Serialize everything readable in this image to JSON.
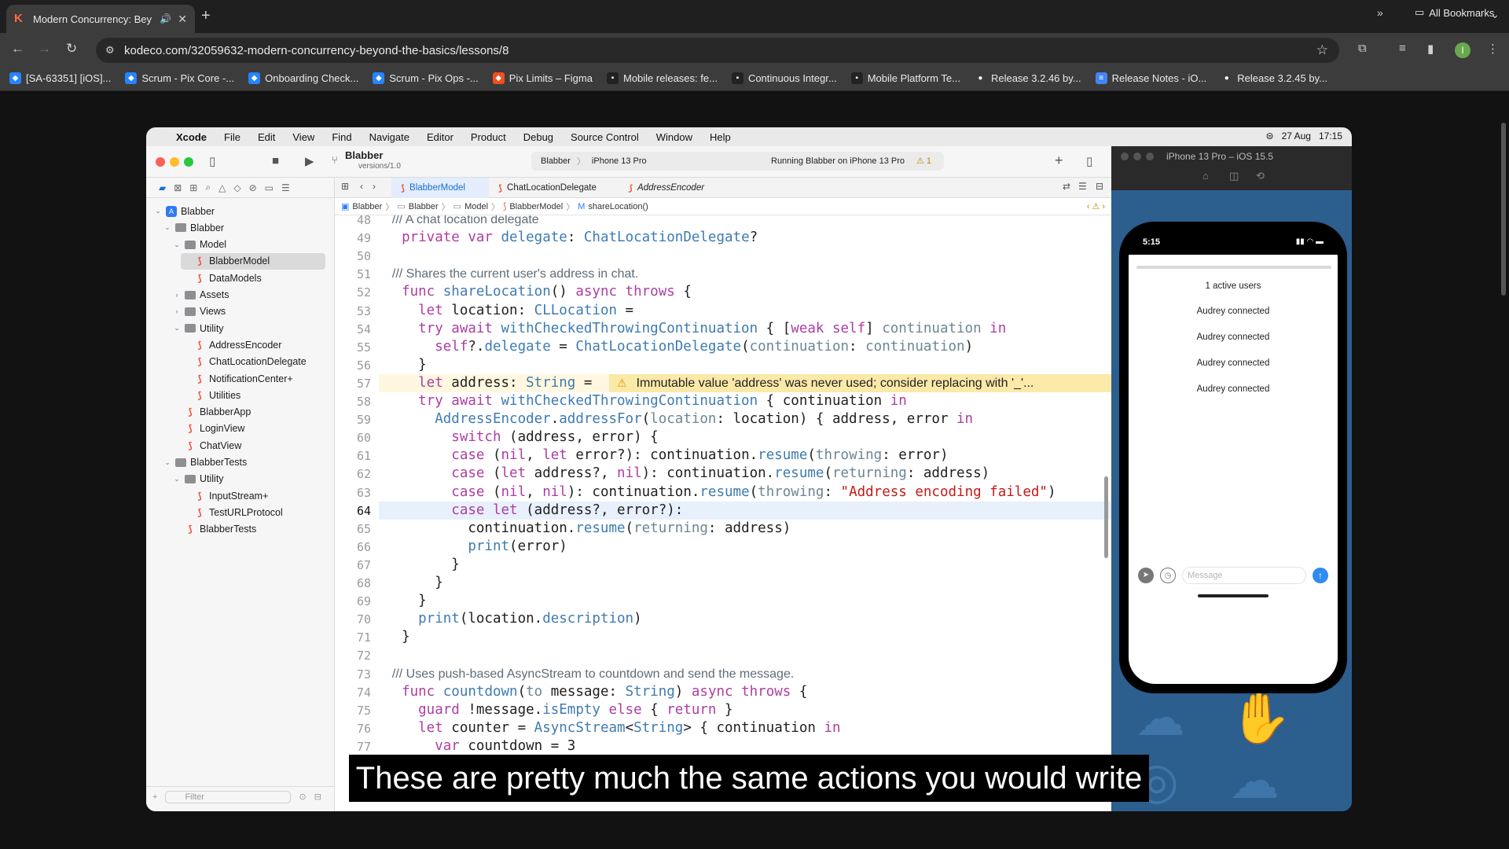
{
  "browser": {
    "tab_title": "Modern Concurrency: Bey",
    "url": "kodeco.com/32059632-modern-concurrency-beyond-the-basics/lessons/8",
    "profile_initial": "I",
    "bookmarks": [
      {
        "label": "[SA-63351] [iOS]...",
        "icon": "jira-icon",
        "color": "#2684ff"
      },
      {
        "label": "Scrum - Pix Core -...",
        "icon": "jira-icon",
        "color": "#2684ff"
      },
      {
        "label": "Onboarding Check...",
        "icon": "jira-icon",
        "color": "#2684ff"
      },
      {
        "label": "Scrum - Pix Ops -...",
        "icon": "jira-icon",
        "color": "#2684ff"
      },
      {
        "label": "Pix Limits – Figma",
        "icon": "figma-icon",
        "color": "#f24e1e"
      },
      {
        "label": "Mobile releases: fe...",
        "icon": "app-icon",
        "color": "#222222"
      },
      {
        "label": "Continuous Integr...",
        "icon": "app-icon",
        "color": "#222222"
      },
      {
        "label": "Mobile Platform Te...",
        "icon": "app-icon",
        "color": "#222222"
      },
      {
        "label": "Release 3.2.46 by...",
        "icon": "github-icon",
        "color": "#ffffff"
      },
      {
        "label": "Release Notes - iO...",
        "icon": "docs-icon",
        "color": "#4285f4"
      },
      {
        "label": "Release 3.2.45 by...",
        "icon": "github-icon",
        "color": "#ffffff"
      }
    ],
    "all_bookmarks": "All Bookmarks"
  },
  "menubar": {
    "app": "Xcode",
    "items": [
      "File",
      "Edit",
      "View",
      "Find",
      "Navigate",
      "Editor",
      "Product",
      "Debug",
      "Source Control",
      "Window",
      "Help"
    ],
    "date": "27 Aug",
    "time": "17:15"
  },
  "xcode": {
    "scheme": "Blabber",
    "scheme_sub": "versions/1.0",
    "run_target": "Blabber",
    "device": "iPhone 13 Pro",
    "status": "Running Blabber on iPhone 13 Pro",
    "warning_count": "1",
    "tabs": [
      "BlabberModel",
      "ChatLocationDelegate",
      "AddressEncoder"
    ],
    "jumpbar": [
      "Blabber",
      "Blabber",
      "Model",
      "BlabberModel",
      "shareLocation()"
    ],
    "filter_placeholder": "Filter",
    "warning_message": "Immutable value 'address' was never used; consider replacing with '_'...",
    "tree": [
      {
        "label": "Blabber",
        "kind": "project",
        "indent": 0,
        "chevron": "v"
      },
      {
        "label": "Blabber",
        "kind": "folder",
        "indent": 1,
        "chevron": "v"
      },
      {
        "label": "Model",
        "kind": "folder",
        "indent": 2,
        "chevron": "v"
      },
      {
        "label": "BlabberModel",
        "kind": "swift",
        "indent": 3,
        "chevron": "",
        "selected": true
      },
      {
        "label": "DataModels",
        "kind": "swift",
        "indent": 3,
        "chevron": ""
      },
      {
        "label": "Assets",
        "kind": "folder",
        "indent": 2,
        "chevron": ">"
      },
      {
        "label": "Views",
        "kind": "folder",
        "indent": 2,
        "chevron": ">"
      },
      {
        "label": "Utility",
        "kind": "folder",
        "indent": 2,
        "chevron": "v"
      },
      {
        "label": "AddressEncoder",
        "kind": "swift",
        "indent": 3,
        "chevron": ""
      },
      {
        "label": "ChatLocationDelegate",
        "kind": "swift",
        "indent": 3,
        "chevron": ""
      },
      {
        "label": "NotificationCenter+",
        "kind": "swift",
        "indent": 3,
        "chevron": ""
      },
      {
        "label": "Utilities",
        "kind": "swift",
        "indent": 3,
        "chevron": ""
      },
      {
        "label": "BlabberApp",
        "kind": "swift",
        "indent": 2,
        "chevron": ""
      },
      {
        "label": "LoginView",
        "kind": "swift",
        "indent": 2,
        "chevron": ""
      },
      {
        "label": "ChatView",
        "kind": "swift",
        "indent": 2,
        "chevron": ""
      },
      {
        "label": "BlabberTests",
        "kind": "folder",
        "indent": 1,
        "chevron": "v"
      },
      {
        "label": "Utility",
        "kind": "folder",
        "indent": 2,
        "chevron": "v"
      },
      {
        "label": "InputStream+",
        "kind": "swift",
        "indent": 3,
        "chevron": ""
      },
      {
        "label": "TestURLProtocol",
        "kind": "swift",
        "indent": 3,
        "chevron": ""
      },
      {
        "label": "BlabberTests",
        "kind": "swift",
        "indent": 2,
        "chevron": ""
      }
    ],
    "current_line": 64,
    "code": [
      {
        "n": 48,
        "t": [
          [
            "doc",
            "  /// A chat location delegate"
          ]
        ]
      },
      {
        "n": 49,
        "t": [
          [
            "kw",
            "  private var "
          ],
          [
            "fn",
            "delegate"
          ],
          [
            "",
            ": "
          ],
          [
            "ty",
            "ChatLocationDelegate"
          ],
          [
            "",
            "?"
          ]
        ]
      },
      {
        "n": 50,
        "t": []
      },
      {
        "n": 51,
        "t": [
          [
            "doc",
            "  /// Shares the current user's address in chat."
          ]
        ]
      },
      {
        "n": 52,
        "t": [
          [
            "kw",
            "  func "
          ],
          [
            "fn",
            "shareLocation"
          ],
          [
            "",
            "() "
          ],
          [
            "kw",
            "async throws"
          ],
          [
            "",
            " {"
          ]
        ]
      },
      {
        "n": 53,
        "t": [
          [
            "kw",
            "    let "
          ],
          [
            "",
            "location: "
          ],
          [
            "ty",
            "CLLocation"
          ],
          [
            "",
            " ="
          ]
        ]
      },
      {
        "n": 54,
        "t": [
          [
            "kw",
            "    try await "
          ],
          [
            "fn",
            "withCheckedThrowingContinuation"
          ],
          [
            "",
            " { ["
          ],
          [
            "kw",
            "weak self"
          ],
          [
            "",
            "] "
          ],
          [
            "lbl",
            "continuation"
          ],
          [
            "kw",
            " in"
          ]
        ]
      },
      {
        "n": 55,
        "t": [
          [
            "kw",
            "      self"
          ],
          [
            "",
            "?."
          ],
          [
            "fn",
            "delegate"
          ],
          [
            "",
            " = "
          ],
          [
            "ty",
            "ChatLocationDelegate"
          ],
          [
            "",
            "("
          ],
          [
            "lbl",
            "continuation"
          ],
          [
            "",
            ": "
          ],
          [
            "lbl",
            "continuation"
          ],
          [
            "",
            ")"
          ]
        ]
      },
      {
        "n": 56,
        "t": [
          [
            "",
            "    }"
          ]
        ]
      },
      {
        "n": 57,
        "t": [
          [
            "kw",
            "    let "
          ],
          [
            "",
            "address: "
          ],
          [
            "ty",
            "String"
          ],
          [
            "",
            " ="
          ]
        ],
        "warn": true
      },
      {
        "n": 58,
        "t": [
          [
            "kw",
            "    try await "
          ],
          [
            "fn",
            "withCheckedThrowingContinuation"
          ],
          [
            "",
            " { continuation "
          ],
          [
            "kw",
            "in"
          ]
        ]
      },
      {
        "n": 59,
        "t": [
          [
            "ty",
            "      AddressEncoder"
          ],
          [
            "",
            "."
          ],
          [
            "fn",
            "addressFor"
          ],
          [
            "",
            "("
          ],
          [
            "lbl",
            "location"
          ],
          [
            "",
            ": location) { address, error "
          ],
          [
            "kw",
            "in"
          ]
        ]
      },
      {
        "n": 60,
        "t": [
          [
            "kw",
            "        switch "
          ],
          [
            "",
            "(address, error) {"
          ]
        ]
      },
      {
        "n": 61,
        "t": [
          [
            "kw",
            "        case "
          ],
          [
            "",
            "("
          ],
          [
            "kw",
            "nil"
          ],
          [
            "",
            ", "
          ],
          [
            "kw",
            "let "
          ],
          [
            "",
            "error?): continuation."
          ],
          [
            "fn",
            "resume"
          ],
          [
            "",
            "("
          ],
          [
            "lbl",
            "throwing"
          ],
          [
            "",
            ": error)"
          ]
        ]
      },
      {
        "n": 62,
        "t": [
          [
            "kw",
            "        case "
          ],
          [
            "",
            "("
          ],
          [
            "kw",
            "let "
          ],
          [
            "",
            "address?, "
          ],
          [
            "kw",
            "nil"
          ],
          [
            "",
            "): continuation."
          ],
          [
            "fn",
            "resume"
          ],
          [
            "",
            "("
          ],
          [
            "lbl",
            "returning"
          ],
          [
            "",
            ": address)"
          ]
        ]
      },
      {
        "n": 63,
        "t": [
          [
            "kw",
            "        case "
          ],
          [
            "",
            "("
          ],
          [
            "kw",
            "nil"
          ],
          [
            "",
            ", "
          ],
          [
            "kw",
            "nil"
          ],
          [
            "",
            "): continuation."
          ],
          [
            "fn",
            "resume"
          ],
          [
            "",
            "("
          ],
          [
            "lbl",
            "throwing"
          ],
          [
            "",
            ": "
          ],
          [
            "str",
            "\"Address encoding failed\""
          ],
          [
            "",
            ")"
          ]
        ]
      },
      {
        "n": 64,
        "t": [
          [
            "kw",
            "        case let "
          ],
          [
            "",
            "(address?, error?):"
          ]
        ]
      },
      {
        "n": 65,
        "t": [
          [
            "",
            "          continuation."
          ],
          [
            "fn",
            "resume"
          ],
          [
            "",
            "("
          ],
          [
            "lbl",
            "returning"
          ],
          [
            "",
            ": address)"
          ]
        ]
      },
      {
        "n": 66,
        "t": [
          [
            "fn",
            "          print"
          ],
          [
            "",
            "(error)"
          ]
        ]
      },
      {
        "n": 67,
        "t": [
          [
            "",
            "        }"
          ]
        ]
      },
      {
        "n": 68,
        "t": [
          [
            "",
            "      }"
          ]
        ]
      },
      {
        "n": 69,
        "t": [
          [
            "",
            "    }"
          ]
        ]
      },
      {
        "n": 70,
        "t": [
          [
            "fn",
            "    print"
          ],
          [
            "",
            "(location."
          ],
          [
            "fn",
            "description"
          ],
          [
            "",
            ")"
          ]
        ]
      },
      {
        "n": 71,
        "t": [
          [
            "",
            "  }"
          ]
        ]
      },
      {
        "n": 72,
        "t": []
      },
      {
        "n": 73,
        "t": [
          [
            "doc",
            "  /// Uses push-based AsyncStream to countdown and send the message."
          ]
        ]
      },
      {
        "n": 74,
        "t": [
          [
            "kw",
            "  func "
          ],
          [
            "fn",
            "countdown"
          ],
          [
            "",
            "("
          ],
          [
            "lbl",
            "to"
          ],
          [
            "",
            " message: "
          ],
          [
            "ty",
            "String"
          ],
          [
            "",
            ") "
          ],
          [
            "kw",
            "async throws"
          ],
          [
            "",
            " {"
          ]
        ]
      },
      {
        "n": 75,
        "t": [
          [
            "kw",
            "    guard "
          ],
          [
            "",
            "!message."
          ],
          [
            "fn",
            "isEmpty"
          ],
          [
            "kw",
            " else"
          ],
          [
            "",
            " { "
          ],
          [
            "kw",
            "return"
          ],
          [
            "",
            " }"
          ]
        ]
      },
      {
        "n": 76,
        "t": [
          [
            "kw",
            "    let "
          ],
          [
            "",
            "counter = "
          ],
          [
            "ty",
            "AsyncStream"
          ],
          [
            "",
            "<"
          ],
          [
            "ty",
            "String"
          ],
          [
            "",
            "> { continuation "
          ],
          [
            "kw",
            "in"
          ]
        ]
      },
      {
        "n": 77,
        "t": [
          [
            "kw",
            "      var "
          ],
          [
            "",
            "countdown = 3"
          ]
        ]
      }
    ]
  },
  "simulator": {
    "title": "iPhone 13 Pro – iOS 15.5",
    "clock": "5:15",
    "active_users": "1 active users",
    "messages": [
      "Audrey connected",
      "Audrey connected",
      "Audrey connected",
      "Audrey connected"
    ],
    "input_placeholder": "Message"
  },
  "caption": "These are pretty much the same actions you would write"
}
